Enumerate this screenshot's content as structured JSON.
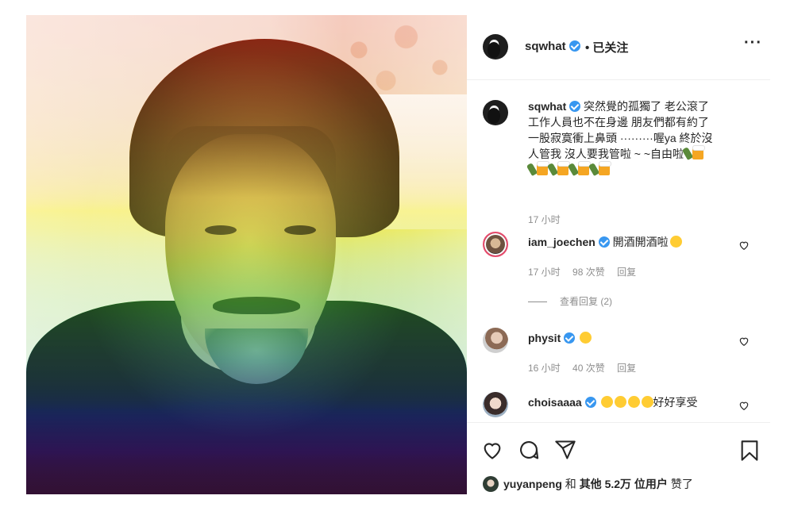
{
  "post": {
    "owner_username": "sqwhat",
    "follow_status": "• 已关注",
    "more_label": "···",
    "caption_line1": "突然覺的孤獨了 老公滾了",
    "caption_line2": "工作人員也不在身邊 朋友們都有約了",
    "caption_line3": "一股寂寞衝上鼻頭 ·········喔ya 終於沒",
    "caption_line4": "人管我 沒人要我管啦 ~ ~自由啦",
    "caption_time": "17 小时"
  },
  "comments": [
    {
      "username": "iam_joechen",
      "text": "開酒開酒啦",
      "time": "17 小时",
      "likes": "98 次赞",
      "reply_label": "回复",
      "view_replies": "查看回复 (2)"
    },
    {
      "username": "physit",
      "text": "",
      "time": "16 小时",
      "likes": "40 次赞",
      "reply_label": "回复"
    },
    {
      "username": "choisaaaa",
      "text": "好好享受"
    }
  ],
  "likes_line": {
    "user": "yuyanpeng",
    "and": "和",
    "others": "其他 5.2万 位用户",
    "liked": "赞了"
  },
  "icons": [
    "more-icon",
    "verified-icon",
    "heart-icon",
    "comment-icon",
    "share-icon",
    "bookmark-icon"
  ],
  "colors": {
    "verified": "#3897f0",
    "text": "#262626",
    "meta": "#8e8e8e",
    "divider": "#efefef"
  }
}
